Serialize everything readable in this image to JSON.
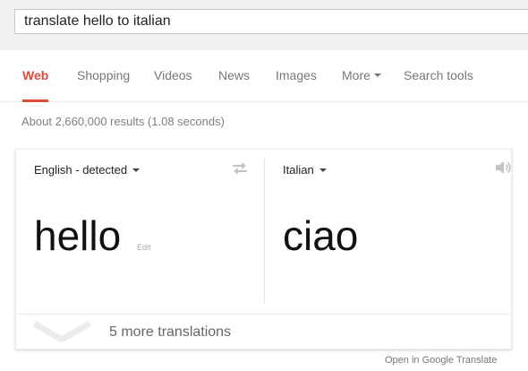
{
  "search": {
    "query": "translate hello to italian"
  },
  "nav": {
    "tabs": [
      {
        "label": "Web",
        "active": true
      },
      {
        "label": "Shopping"
      },
      {
        "label": "Videos"
      },
      {
        "label": "News"
      },
      {
        "label": "Images"
      },
      {
        "label": "More"
      },
      {
        "label": "Search tools"
      }
    ]
  },
  "results": {
    "stats": "About 2,660,000 results (1.08 seconds)"
  },
  "translate": {
    "source": {
      "language": "English - detected",
      "text": "hello",
      "edit_label": "Edit"
    },
    "target": {
      "language": "Italian",
      "text": "ciao"
    },
    "more_translations": "5 more translations",
    "open_link": "Open in Google Translate"
  },
  "colors": {
    "accent": "#dd4b39",
    "muted_text": "#777777",
    "band": "#f1f1f1"
  }
}
